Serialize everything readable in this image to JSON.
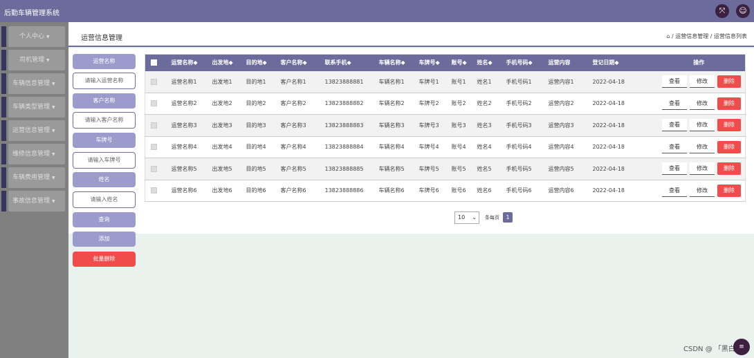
{
  "app": {
    "title": "后勤车辆管理系统",
    "icon_fullscreen": "fullscreen-icon",
    "icon_user": "user-icon"
  },
  "sidebar": {
    "items": [
      {
        "label": "个人中心"
      },
      {
        "label": "司机管理"
      },
      {
        "label": "车辆信息管理"
      },
      {
        "label": "车辆类型管理"
      },
      {
        "label": "运营信息管理"
      },
      {
        "label": "维修信息管理"
      },
      {
        "label": "车辆费用管理"
      },
      {
        "label": "事故信息管理"
      }
    ]
  },
  "header": {
    "title": "运营信息管理",
    "breadcrumb": "/ 运营信息管理 / 运营信息列表"
  },
  "search": {
    "label_name": "运营名称",
    "placeholder_name": "请输入运营名称",
    "label_customer": "客户名称",
    "placeholder_customer": "请输入客户名称",
    "label_plate": "车牌号",
    "placeholder_plate": "请输入车牌号",
    "label_person": "姓名",
    "placeholder_person": "请输入姓名",
    "query": "查询",
    "add": "添加",
    "batch_delete": "批量删除"
  },
  "table": {
    "columns": [
      "运营名称◆",
      "出发地◆",
      "目的地◆",
      "客户名称◆",
      "联系手机◆",
      "车辆名称◆",
      "车牌号◆",
      "账号◆",
      "姓名◆",
      "手机号码◆",
      "运营内容",
      "登记日期◆",
      "操作"
    ],
    "rows": [
      [
        "运营名称1",
        "出发地1",
        "目的地1",
        "客户名称1",
        "13823888881",
        "车辆名称1",
        "车牌号1",
        "账号1",
        "姓名1",
        "手机号码1",
        "运营内容1",
        "2022-04-18"
      ],
      [
        "运营名称2",
        "出发地2",
        "目的地2",
        "客户名称2",
        "13823888882",
        "车辆名称2",
        "车牌号2",
        "账号2",
        "姓名2",
        "手机号码2",
        "运营内容2",
        "2022-04-18"
      ],
      [
        "运营名称3",
        "出发地3",
        "目的地3",
        "客户名称3",
        "13823888883",
        "车辆名称3",
        "车牌号3",
        "账号3",
        "姓名3",
        "手机号码3",
        "运营内容3",
        "2022-04-18"
      ],
      [
        "运营名称4",
        "出发地4",
        "目的地4",
        "客户名称4",
        "13823888884",
        "车辆名称4",
        "车牌号4",
        "账号4",
        "姓名4",
        "手机号码4",
        "运营内容4",
        "2022-04-18"
      ],
      [
        "运营名称5",
        "出发地5",
        "目的地5",
        "客户名称5",
        "13823888885",
        "车辆名称5",
        "车牌号5",
        "账号5",
        "姓名5",
        "手机号码5",
        "运营内容5",
        "2022-04-18"
      ],
      [
        "运营名称6",
        "出发地6",
        "目的地6",
        "客户名称6",
        "13823888886",
        "车辆名称6",
        "车牌号6",
        "账号6",
        "姓名6",
        "手机号码6",
        "运营内容6",
        "2022-04-18"
      ]
    ],
    "actions": {
      "view": "查看",
      "edit": "修改",
      "delete": "删除"
    }
  },
  "pagination": {
    "page_size": "10",
    "per_page_label": "条每页",
    "current_page": "1"
  },
  "watermark": "CSDN @ 「黑白」",
  "colors": {
    "accent": "#6c6c9c",
    "danger": "#f24b4b",
    "sidebar": "#808080"
  }
}
